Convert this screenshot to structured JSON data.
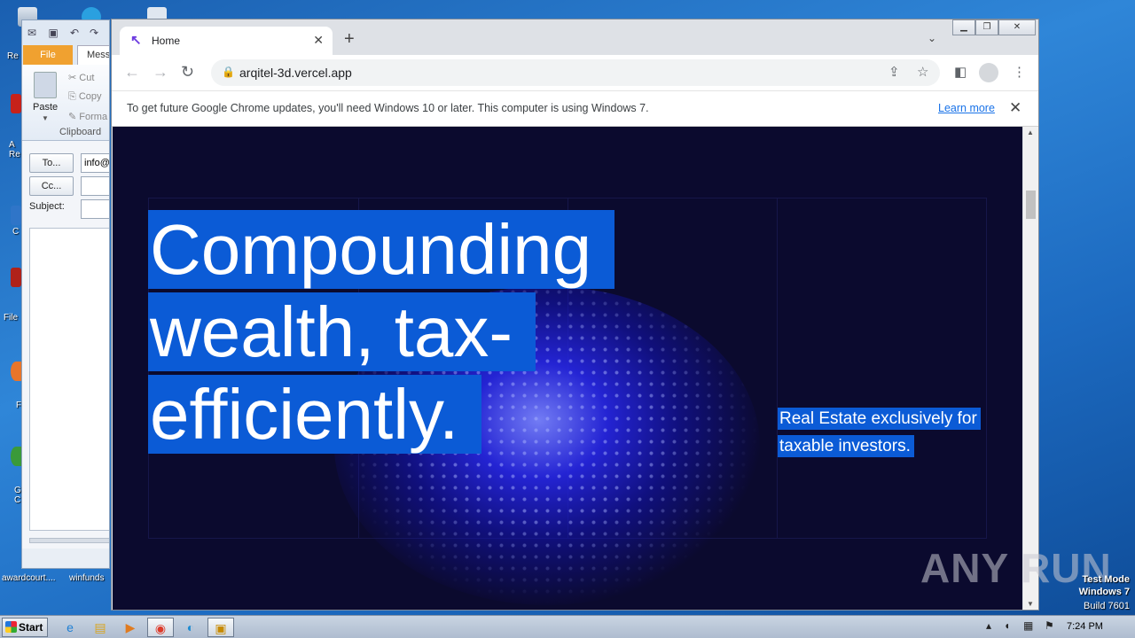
{
  "desktop": {
    "icons": [
      {
        "label": "Re",
        "name": "recycle-bin-icon"
      },
      {
        "label": "A Re",
        "name": "acrobat-reader-icon"
      },
      {
        "label": "C",
        "name": "ccleaner-icon"
      },
      {
        "label": "File",
        "name": "filezilla-icon"
      },
      {
        "label": "F",
        "name": "firefox-icon"
      },
      {
        "label": "G C",
        "name": "google-chrome-icon"
      }
    ],
    "bottom_labels": [
      "awardcourt....",
      "winfunds"
    ],
    "watermark": "ANY RUN",
    "test_mode": [
      "Test Mode",
      "Windows 7",
      "Build 7601"
    ]
  },
  "outlook": {
    "tabs": {
      "file": "File",
      "message": "Mess"
    },
    "ribbon": {
      "paste": "Paste",
      "cut": "Cut",
      "copy": "Copy",
      "format": "Forma",
      "group": "Clipboard"
    },
    "form": {
      "to_button": "To...",
      "cc_button": "Cc...",
      "to_value": "info@",
      "cc_value": "",
      "subject_label": "Subject:",
      "subject_value": ""
    }
  },
  "chrome": {
    "tab_title": "Home",
    "url": "arqitel-3d.vercel.app",
    "infobar_text": "To get future Google Chrome updates, you'll need Windows 10 or later. This computer is using Windows 7.",
    "infobar_link": "Learn more"
  },
  "page": {
    "headline_lines": [
      "Compounding",
      "wealth, tax-",
      "efficiently."
    ],
    "tagline_lines": [
      "Real Estate exclusively for",
      "taxable investors."
    ],
    "colors": {
      "background": "#0b0a2e",
      "highlight": "#0b5bd6",
      "glow": "#2828f0"
    }
  },
  "taskbar": {
    "start": "Start",
    "clock": "7:24 PM",
    "apps": [
      "internet-explorer-icon",
      "file-explorer-icon",
      "media-player-icon",
      "chrome-icon",
      "edge-icon",
      "outlook-icon"
    ]
  }
}
